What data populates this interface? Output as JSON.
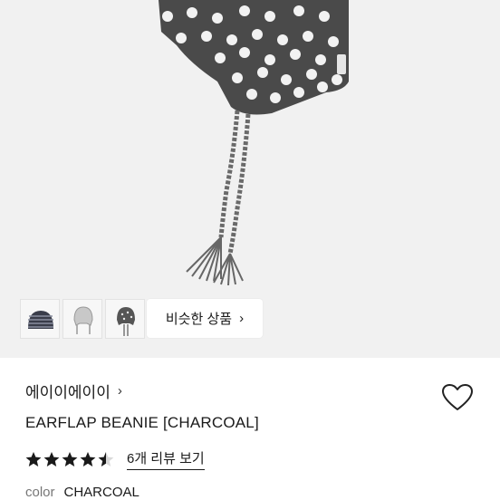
{
  "similar_button": {
    "label": "비슷한 상품",
    "chevron": "›"
  },
  "brand": {
    "name": "에이이에이이",
    "chevron": "›"
  },
  "product": {
    "title": "EARFLAP BEANIE [CHARCOAL]"
  },
  "rating": {
    "stars": 4.5,
    "max": 5,
    "review_link": "6개 리뷰 보기"
  },
  "color": {
    "label": "color",
    "value": "CHARCOAL"
  },
  "icons": {
    "wishlist": "heart-icon",
    "star": "star-icon"
  },
  "colors": {
    "accent": "#1a1a1a",
    "hero_bg": "#f1f1f1",
    "hat": "#4a4a4a"
  }
}
